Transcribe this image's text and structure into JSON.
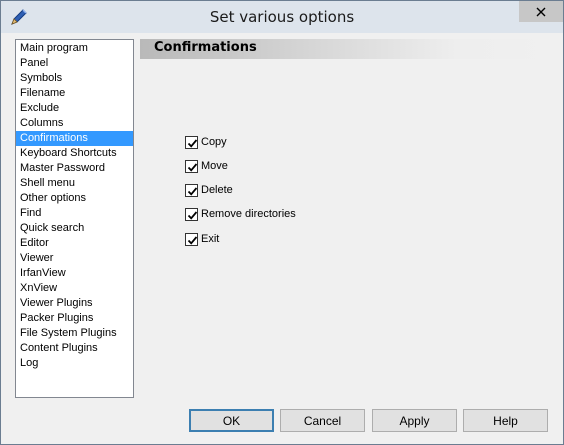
{
  "window": {
    "title": "Set various options",
    "icon": "pen-icon",
    "close_icon": "close-icon"
  },
  "nav": {
    "selected_index": 6,
    "items": [
      {
        "label": "Main program"
      },
      {
        "label": "Panel"
      },
      {
        "label": "Symbols"
      },
      {
        "label": "Filename"
      },
      {
        "label": "Exclude"
      },
      {
        "label": "Columns"
      },
      {
        "label": "Confirmations"
      },
      {
        "label": "Keyboard Shortcuts"
      },
      {
        "label": "Master Password"
      },
      {
        "label": "Shell menu"
      },
      {
        "label": "Other options"
      },
      {
        "label": "Find"
      },
      {
        "label": "Quick search"
      },
      {
        "label": "Editor"
      },
      {
        "label": "Viewer"
      },
      {
        "label": "IrfanView"
      },
      {
        "label": "XnView"
      },
      {
        "label": "Viewer Plugins"
      },
      {
        "label": "Packer Plugins"
      },
      {
        "label": "File System Plugins"
      },
      {
        "label": "Content Plugins"
      },
      {
        "label": "Log"
      }
    ]
  },
  "section": {
    "title": "Confirmations"
  },
  "options": [
    {
      "label": "Copy",
      "checked": true
    },
    {
      "label": "Move",
      "checked": true
    },
    {
      "label": "Delete",
      "checked": true
    },
    {
      "label": "Remove directories",
      "checked": true
    },
    {
      "label": "Exit",
      "checked": true
    }
  ],
  "buttons": {
    "ok": "OK",
    "cancel": "Cancel",
    "apply": "Apply",
    "help": "Help"
  },
  "colors": {
    "selection": "#3399ff",
    "titlebar": "#dde4ec",
    "close_button": "#c7c7c7"
  }
}
